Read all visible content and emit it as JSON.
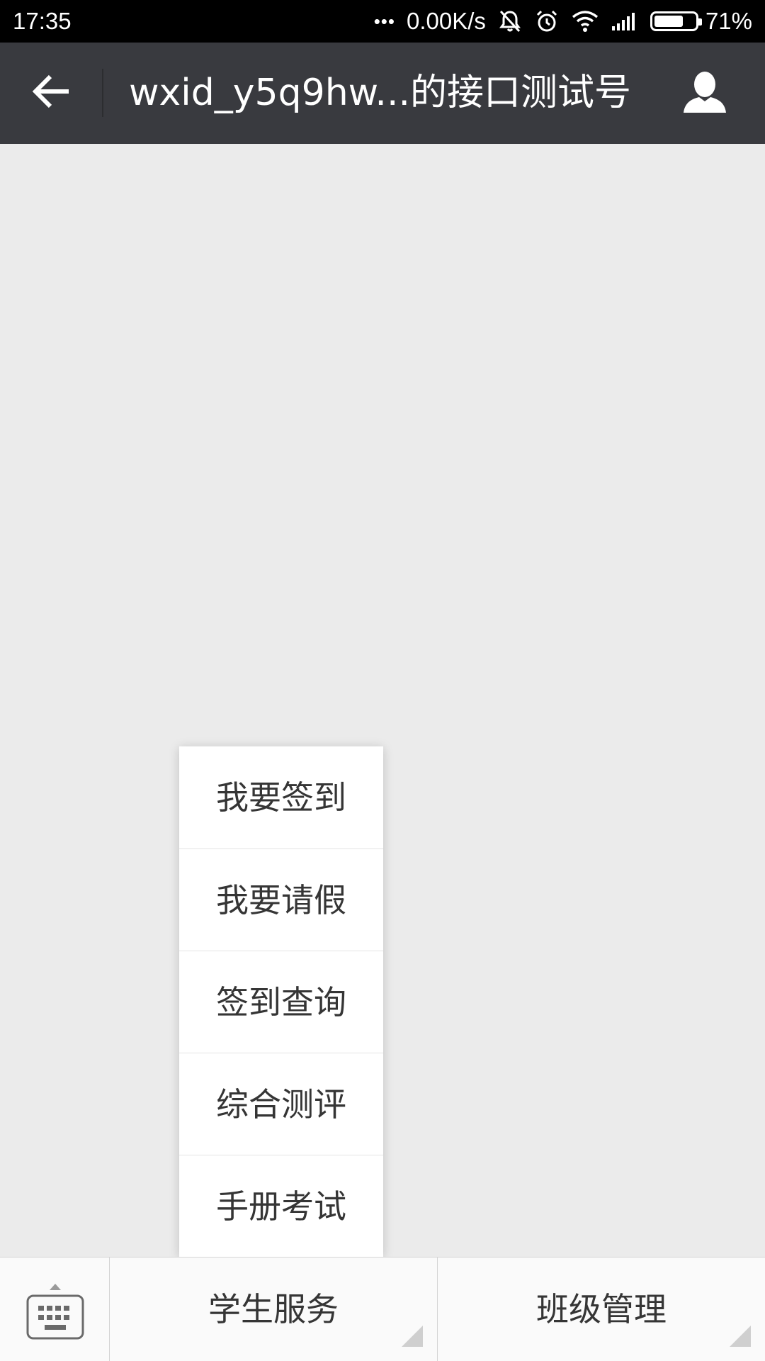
{
  "status_bar": {
    "time": "17:35",
    "dots": "•••",
    "net_speed": "0.00K/s",
    "battery_level": 0.71,
    "battery_percent": "71%"
  },
  "header": {
    "title": "wxid_y5q9hw...的接口测试号",
    "back_icon": "arrow-left-icon",
    "profile_icon": "person-icon"
  },
  "popup_menu": {
    "items": [
      {
        "label": "我要签到"
      },
      {
        "label": "我要请假"
      },
      {
        "label": "签到查询"
      },
      {
        "label": "综合测评"
      },
      {
        "label": "手册考试"
      }
    ]
  },
  "bottom_menu": {
    "keyboard_icon": "keyboard-icon",
    "tabs": [
      {
        "label": "学生服务"
      },
      {
        "label": "班级管理"
      }
    ]
  },
  "colors": {
    "status_bar_bg": "#000000",
    "title_bar_bg": "#393a3f",
    "content_bg": "#ebebeb",
    "menu_bg": "#ffffff",
    "text": "#353535"
  }
}
